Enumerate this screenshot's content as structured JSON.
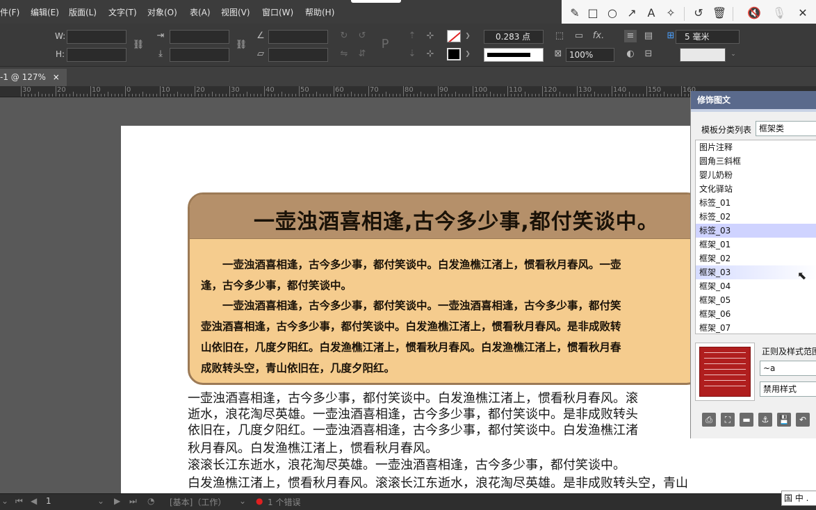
{
  "menu": [
    "件(F)",
    "编辑(E)",
    "版面(L)",
    "文字(T)",
    "对象(O)",
    "表(A)",
    "视图(V)",
    "窗口(W)",
    "帮助(H)"
  ],
  "control": {
    "w_label": "W:",
    "h_label": "H:",
    "stroke_weight": "0.283 点",
    "opacity": "100%",
    "spacing": "5 毫米"
  },
  "tab": {
    "label": "-1 @ 127%",
    "close": "×"
  },
  "ruler_ticks": [
    "30",
    "20",
    "10",
    "0",
    "10",
    "20",
    "30",
    "40",
    "50",
    "60",
    "70",
    "80",
    "90",
    "100",
    "110",
    "120",
    "130",
    "140",
    "150",
    "160"
  ],
  "frame": {
    "title": "一壶浊酒喜相逢,古今多少事,都付笑谈中。",
    "lines": [
      "　　一壶浊酒喜相逢，古今多少事，都付笑谈中。白发渔樵江渚上，惯看秋月春风。一壶",
      "逢，古今多少事，都付笑谈中。",
      "　　一壶浊酒喜相逢，古今多少事，都付笑谈中。一壶浊酒喜相逢，古今多少事，都付笑",
      "壶浊酒喜相逢，古今多少事，都付笑谈中。白发渔樵江渚上，惯看秋月春风。是非成败转",
      "山依旧在，几度夕阳红。白发渔樵江渚上，惯看秋月春风。白发渔樵江渚上，惯看秋月春",
      " 成败转头空，青山依旧在，几度夕阳红。"
    ]
  },
  "body_lines": [
    "一壶浊酒喜相逢，古今多少事，都付笑谈中。白发渔樵江渚上，惯看秋月春风。滚",
    "逝水，浪花淘尽英雄。一壶浊酒喜相逢，古今多少事，都付笑谈中。是非成败转头",
    "依旧在，几度夕阳红。一壶浊酒喜相逢，古今多少事，都付笑谈中。白发渔樵江渚",
    "秋月春风。白发渔樵江渚上，惯看秋月春风。",
    "滚滚长江东逝水，浪花淘尽英雄。一壶浊酒喜相逢，古今多少事，都付笑谈中。",
    "白发渔樵江渚上，惯看秋月春风。滚滚长江东逝水，浪花淘尽英雄。是非成败转头空，青山"
  ],
  "panel": {
    "title": "修饰图文",
    "category_label": "模板分类列表",
    "category_value": "框架类",
    "items": [
      "图片注释",
      "圆角三斜框",
      "婴儿奶粉",
      "文化驿站",
      "标签_01",
      "标签_02",
      "标签_03",
      "框架_01",
      "框架_02",
      "框架_03",
      "框架_04",
      "框架_05",
      "框架_06",
      "框架_07"
    ],
    "rule_label": "正则及样式范围",
    "rule_value": "~a",
    "style_value": "禁用样式"
  },
  "status": {
    "page": "1",
    "style": "[基本]（工作）",
    "errors": "1 个错误"
  },
  "ime": "国 中 ."
}
